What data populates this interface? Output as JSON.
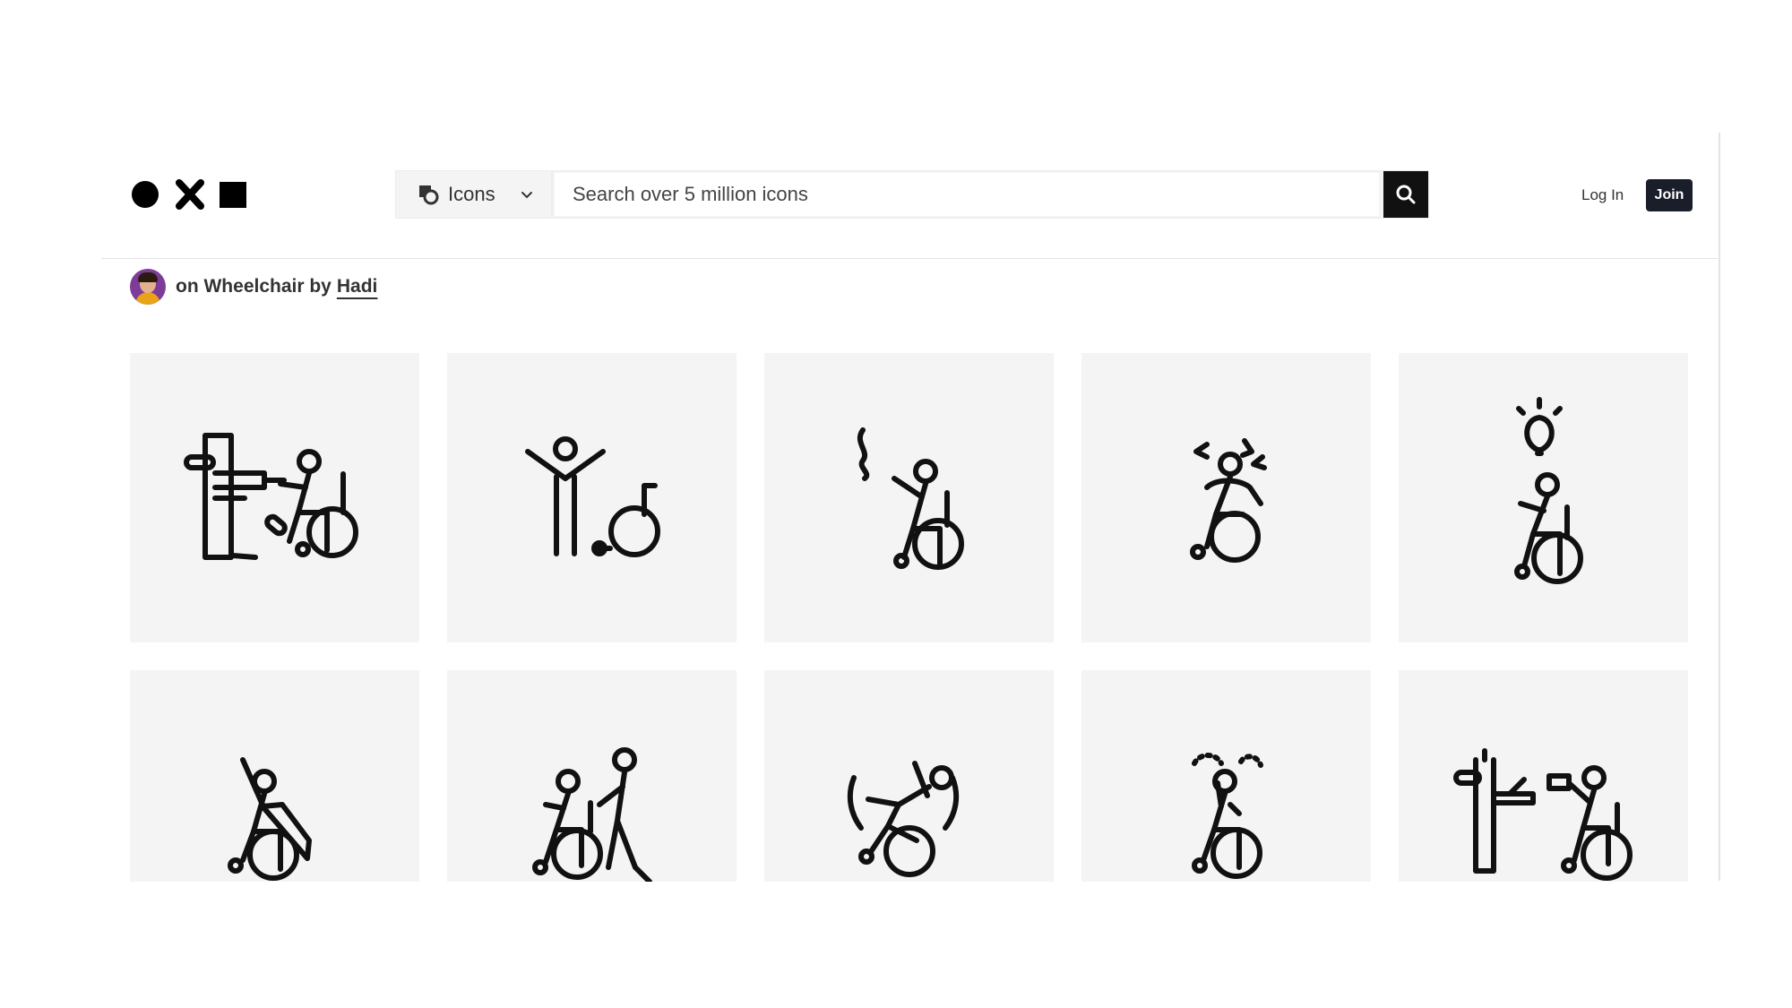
{
  "header": {
    "logo_icons": [
      "circle-icon",
      "cross-icon",
      "square-icon"
    ],
    "type_select": {
      "label": "Icons",
      "icon": "icons-type-icon"
    },
    "search": {
      "placeholder": "Search over 5 million icons",
      "value": ""
    },
    "login_label": "Log In",
    "join_label": "Join"
  },
  "collection": {
    "title": "on Wheelchair by",
    "author": "Hadi"
  },
  "icons": [
    "wheelchair-user-at-workbench-icon",
    "person-with-empty-wheelchair-icon",
    "wheelchair-user-waving-icon",
    "wheelchair-user-stressed-icon",
    "wheelchair-user-with-idea-icon",
    "wheelchair-user-superhero-icon",
    "person-pushing-wheelchair-icon",
    "wheelchair-user-falling-icon",
    "wheelchair-user-confused-icon",
    "wheelchair-user-at-machine-icon"
  ],
  "colors": {
    "tile_bg": "#f4f4f5",
    "join_bg": "#1a1e2b",
    "search_btn_bg": "#111111"
  }
}
